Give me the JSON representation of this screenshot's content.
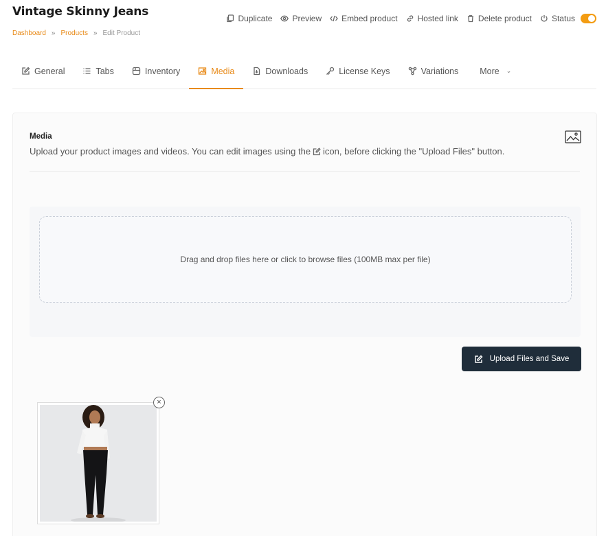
{
  "header": {
    "title": "Vintage Skinny Jeans",
    "breadcrumb": {
      "dashboard": "Dashboard",
      "products": "Products",
      "current": "Edit Product",
      "separator": "»"
    }
  },
  "actions": {
    "duplicate": "Duplicate",
    "preview": "Preview",
    "embed": "Embed product",
    "hosted_link": "Hosted link",
    "delete": "Delete product",
    "status": "Status",
    "status_on": true
  },
  "tabs": [
    {
      "label": "General",
      "icon": "edit-icon"
    },
    {
      "label": "Tabs",
      "icon": "list-icon"
    },
    {
      "label": "Inventory",
      "icon": "box-icon"
    },
    {
      "label": "Media",
      "icon": "image-icon",
      "active": true
    },
    {
      "label": "Downloads",
      "icon": "file-icon"
    },
    {
      "label": "License Keys",
      "icon": "key-icon"
    },
    {
      "label": "Variations",
      "icon": "variations-icon"
    },
    {
      "label": "More",
      "icon": "chevron-down-icon"
    }
  ],
  "media": {
    "title": "Media",
    "desc_before": "Upload your product images and videos. You can edit images using the",
    "desc_after": "icon, before clicking the \"Upload Files\" button.",
    "dropzone_text": "Drag and drop files here or click to browse files (100MB max per file)",
    "upload_button": "Upload Files and Save",
    "remove_symbol": "×"
  },
  "colors": {
    "accent": "#e88a18",
    "button_dark": "#1f2d3a",
    "toggle": "#f39c12"
  }
}
